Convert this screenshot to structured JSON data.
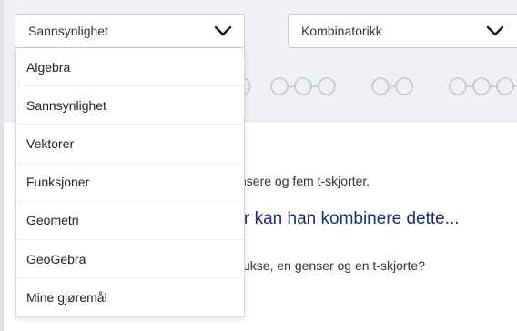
{
  "left_select": {
    "value": "Sannsynlighet"
  },
  "right_select": {
    "value": "Kombinatorikk"
  },
  "dropdown": {
    "items": [
      {
        "label": "Algebra"
      },
      {
        "label": "Sannsynlighet"
      },
      {
        "label": "Vektorer"
      },
      {
        "label": "Funksjoner"
      },
      {
        "label": "Geometri"
      },
      {
        "label": "GeoGebra"
      },
      {
        "label": "Mine gjøremål"
      }
    ]
  },
  "content": {
    "line1": "nsere og fem t-skjorter.",
    "line2": "r kan han kombinere dette...",
    "line3": "ukse, en genser og en t-skjorte?"
  },
  "colors": {
    "accent": "#1f2d6b",
    "band": "#eef0f4",
    "step_circle": "#c3c7ce"
  }
}
